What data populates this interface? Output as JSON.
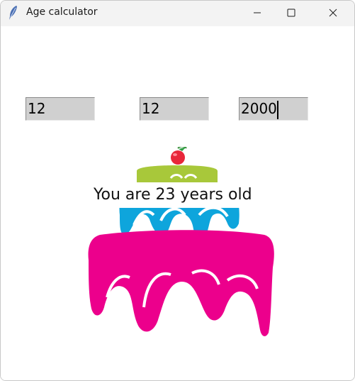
{
  "window": {
    "title": "Age calculator",
    "controls": {
      "minimize_icon": "minimize-icon",
      "maximize_icon": "maximize-icon",
      "close_icon": "close-icon"
    }
  },
  "form": {
    "day": "12",
    "month": "12",
    "year": "2000"
  },
  "result": {
    "text": "You are 23 years old"
  },
  "colors": {
    "entry_bg": "#d0d0d0",
    "cake_top": "#a8c83a",
    "cake_middle": "#0ea5dc",
    "cake_bottom": "#ec008c",
    "cherry": "#e8273a"
  }
}
